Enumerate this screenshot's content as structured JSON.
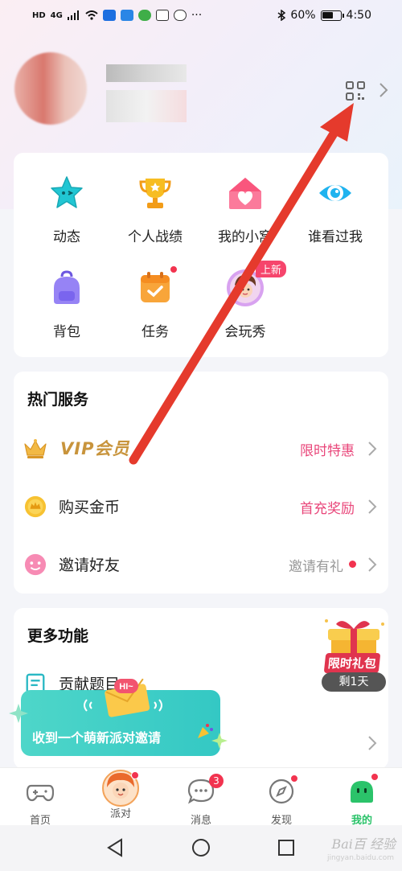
{
  "status_bar": {
    "left_tags": [
      "HD",
      "4G"
    ],
    "battery": "60%",
    "time": "4:50"
  },
  "profile": {
    "qr_icon": "qr-code-icon",
    "chevron_icon": "chevron-right-icon"
  },
  "features": [
    {
      "label": "动态",
      "icon": "star-face-icon",
      "color": "#20c3d0"
    },
    {
      "label": "个人战绩",
      "icon": "trophy-icon",
      "color": "#f5b51d"
    },
    {
      "label": "我的小窝",
      "icon": "house-heart-icon",
      "color": "#f57a98"
    },
    {
      "label": "谁看过我",
      "icon": "eye-icon",
      "color": "#1ab1ee"
    },
    {
      "label": "背包",
      "icon": "backpack-icon",
      "color": "#8a74f0"
    },
    {
      "label": "任务",
      "icon": "calendar-check-icon",
      "color": "#f7a235"
    },
    {
      "label": "会玩秀",
      "icon": "avatar-show-icon",
      "color": "#c77dea"
    }
  ],
  "feature_badge_new": "上新",
  "hot_services": {
    "title": "热门服务",
    "rows": [
      {
        "label": "VIP会员",
        "right": "限时特惠",
        "right_color": "#e9467a",
        "icon": "crown-icon"
      },
      {
        "label": "购买金币",
        "right": "首充奖励",
        "right_color": "#e9467a",
        "icon": "gold-coin-icon"
      },
      {
        "label": "邀请好友",
        "right": "邀请有礼",
        "right_color": "#999999",
        "icon": "smiley-icon"
      }
    ]
  },
  "more_features": {
    "title": "更多功能",
    "rows": [
      {
        "label": "贡献题目",
        "icon": "document-icon"
      }
    ]
  },
  "gift_promo": {
    "tag": "限时礼包",
    "countdown": "剩1天"
  },
  "invite_toast": {
    "bubble": "HI~",
    "text": "收到一个萌新派对邀请"
  },
  "tabbar": {
    "tabs": [
      {
        "label": "首页",
        "icon": "gamepad-icon"
      },
      {
        "label": "派对",
        "icon": "party-avatar-icon"
      },
      {
        "label": "消息",
        "icon": "chat-icon"
      },
      {
        "label": "发现",
        "icon": "compass-icon"
      },
      {
        "label": "我的",
        "icon": "me-face-icon"
      }
    ],
    "message_badge": "3",
    "active_color": "#2bc36a"
  },
  "watermark": {
    "text": "Bai百 经验",
    "url": "jingyan.baidu.com"
  }
}
